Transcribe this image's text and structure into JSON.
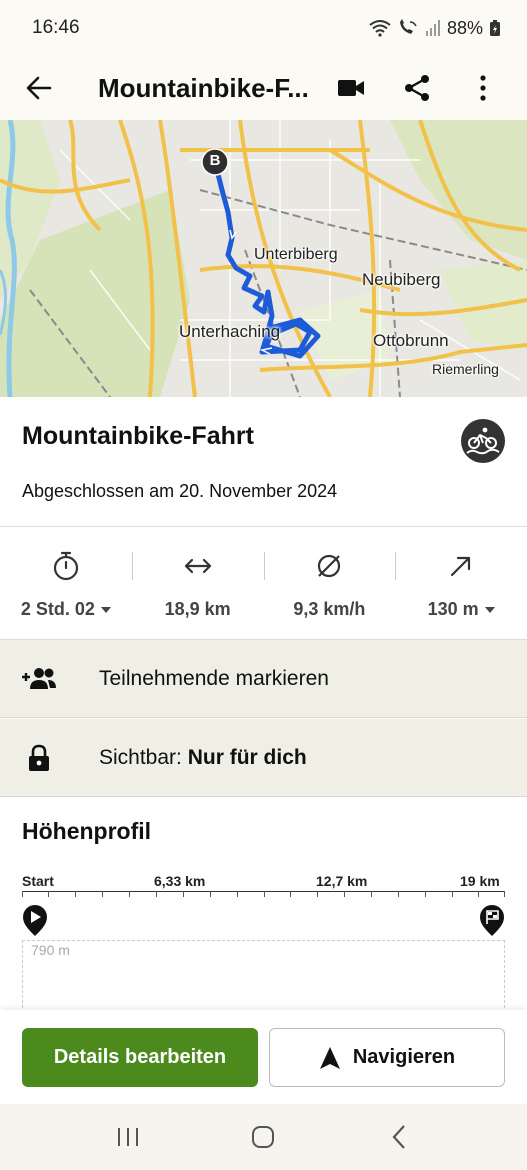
{
  "status_bar": {
    "time": "16:46",
    "battery": "88%"
  },
  "app_bar": {
    "title": "Mountainbike-F...",
    "icons": [
      "back-arrow-icon",
      "video-icon",
      "share-icon",
      "more-vert-icon"
    ]
  },
  "map": {
    "start_marker": "B",
    "places": [
      "Unterbiberg",
      "Neubiberg",
      "Unterhaching",
      "Ottobrunn",
      "Riemerling"
    ]
  },
  "tour": {
    "title": "Mountainbike-Fahrt",
    "date": "Abgeschlossen am 20. November 2024",
    "sport_icon": "mountain-bike-icon"
  },
  "stats": [
    {
      "icon": "stopwatch-icon",
      "value": "2 Std. 02",
      "dropdown": true
    },
    {
      "icon": "distance-icon",
      "value": "18,9 km",
      "dropdown": false
    },
    {
      "icon": "average-speed-icon",
      "value": "9,3 km/h",
      "dropdown": false
    },
    {
      "icon": "ascent-icon",
      "value": "130 m",
      "dropdown": true
    }
  ],
  "rows": {
    "participants": "Teilnehmende markieren",
    "visibility_label": "Sichtbar:",
    "visibility_value": "Nur für dich"
  },
  "elevation": {
    "title": "Höhenprofil",
    "km_labels": [
      "Start",
      "6,33 km",
      "12,7 km",
      "19 km"
    ],
    "y_label": "790 m"
  },
  "buttons": {
    "edit": "Details bearbeiten",
    "navigate": "Navigieren"
  },
  "colors": {
    "accent_green": "#4d8a1d",
    "route_blue": "#1e5bd8",
    "row_bg": "#efefe5"
  }
}
